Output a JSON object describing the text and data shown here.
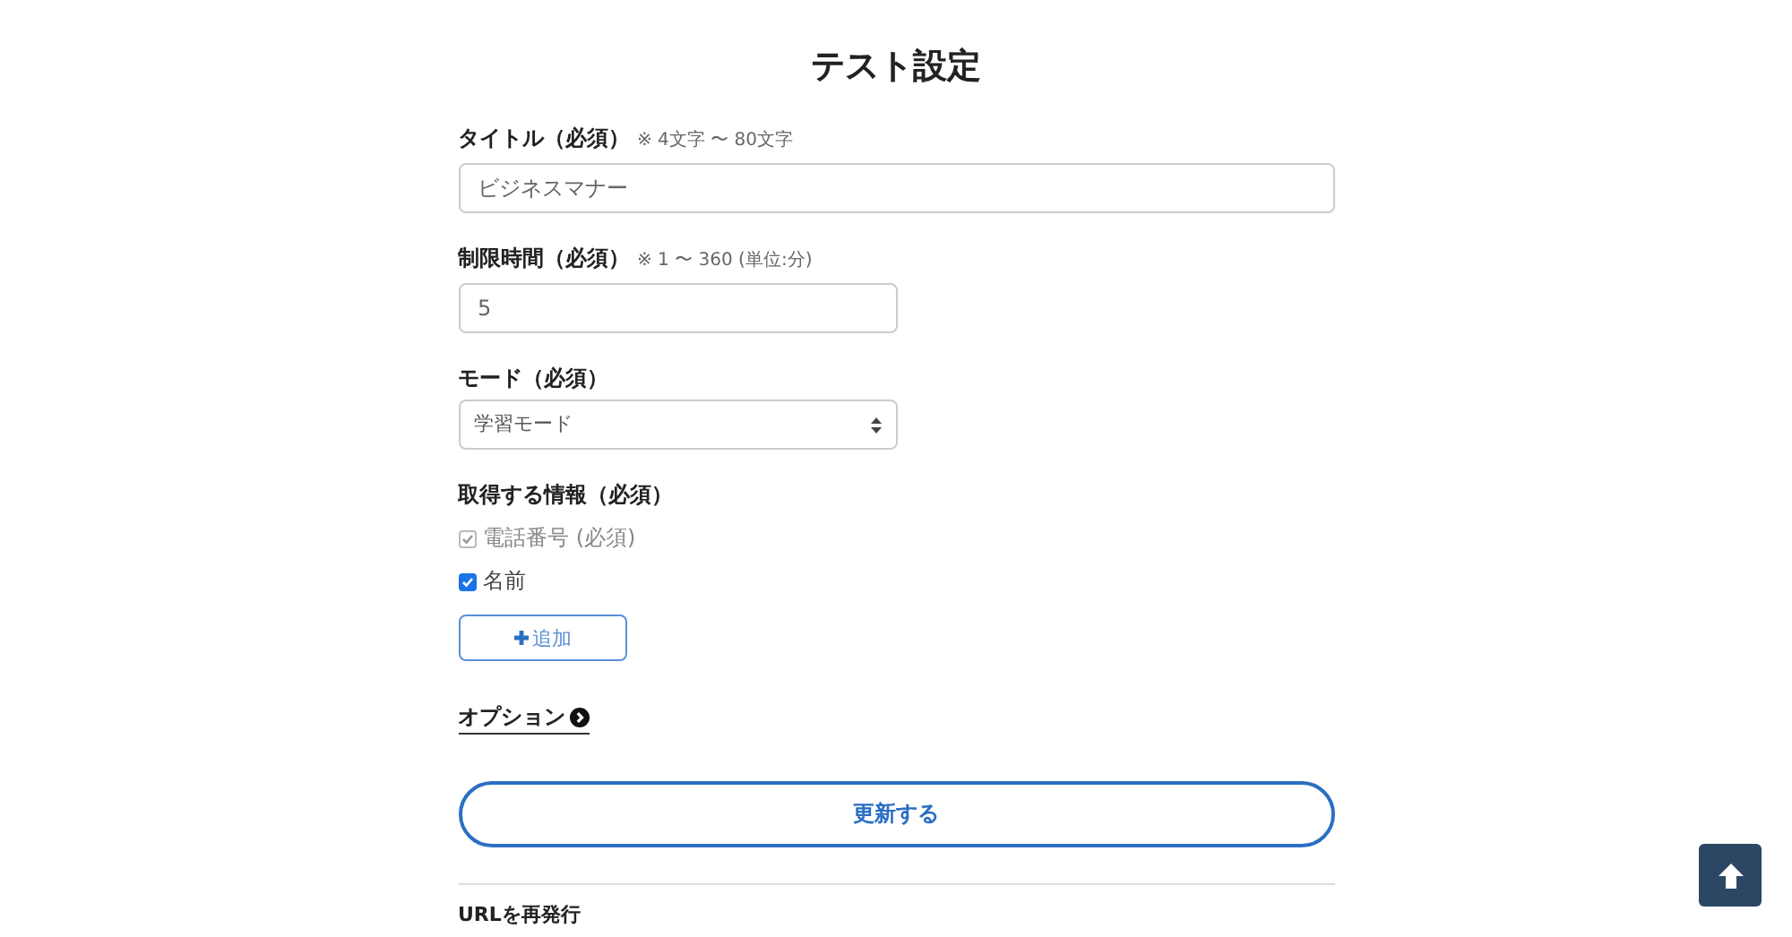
{
  "page_title": "テスト設定",
  "fields": [
    {
      "kind": "text",
      "label": "タイトル（必須）",
      "note": "※ 4文字 〜 80文字",
      "value": "ビジネスマナー",
      "wide": true
    },
    {
      "kind": "text",
      "label": "制限時間（必須）",
      "note": "※ 1 〜 360 (単位:分)",
      "value": "5",
      "wide": false
    },
    {
      "kind": "select",
      "label": "モード（必須）",
      "value": "学習モード",
      "wide": false
    }
  ],
  "info": {
    "label": "取得する情報（必須）",
    "items": [
      {
        "label": "電話番号 (必須)",
        "checked": true,
        "disabled": true
      },
      {
        "label": "名前",
        "checked": true,
        "disabled": false
      }
    ],
    "add_button": "追加"
  },
  "options_link": "オプション",
  "submit_button": "更新する",
  "reissue_heading": "URLを再発行"
}
